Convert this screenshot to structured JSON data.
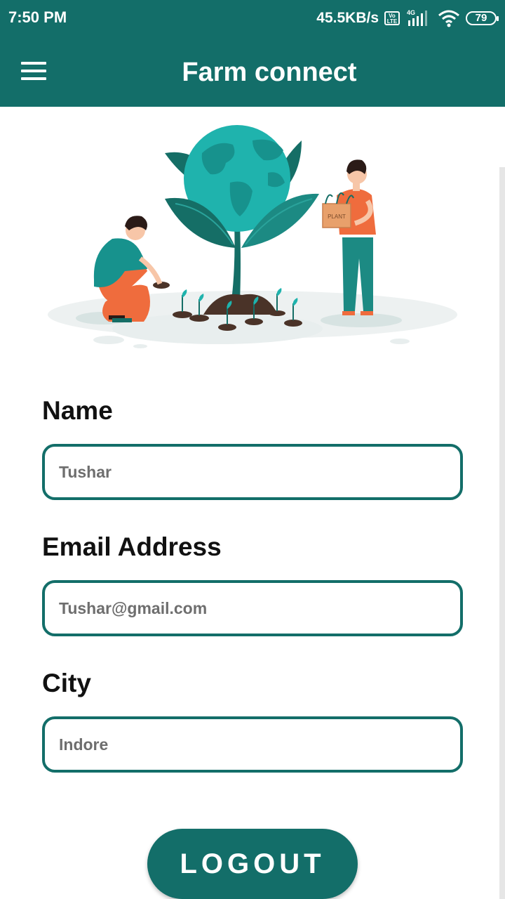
{
  "status_bar": {
    "time": "7:50 PM",
    "net_speed": "45.5KB/s",
    "volte": "Vo\nLTE",
    "network_type": "4G",
    "battery": "79",
    "icons": [
      "volte-icon",
      "signal-icon",
      "wifi-icon",
      "battery-icon"
    ]
  },
  "app_bar": {
    "title": "Farm connect",
    "menu_icon": "hamburger-menu-icon"
  },
  "illustration": {
    "subject": "two people planting seedlings around a globe-shaped tree",
    "box_text": "PLANT"
  },
  "form": {
    "name": {
      "label": "Name",
      "value": "Tushar"
    },
    "email": {
      "label": "Email Address",
      "value": "Tushar@gmail.com"
    },
    "city": {
      "label": "City",
      "value": "Indore"
    }
  },
  "logout_label": "LOGOUT",
  "colors": {
    "primary": "#136e69",
    "globe": "#1fb3ad",
    "leaf": "#156e66",
    "accent_orange": "#ef6c3d",
    "background": "#ffffff"
  }
}
